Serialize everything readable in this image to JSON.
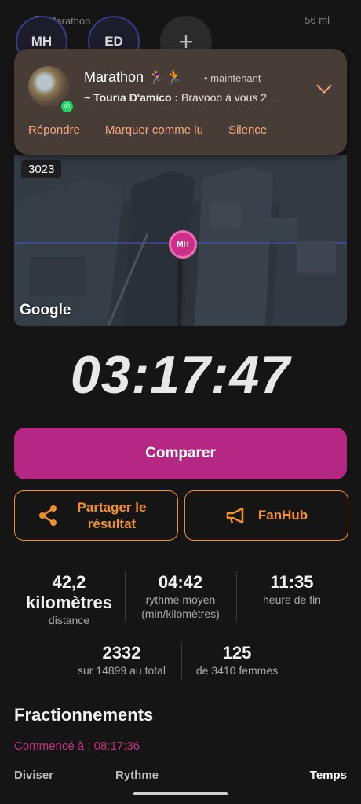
{
  "status_bar": {
    "app": "Marathon",
    "time": "56 ml"
  },
  "top_avatars": [
    {
      "initials": "MH"
    },
    {
      "initials": "ED"
    },
    {
      "initials": "+"
    }
  ],
  "notification": {
    "title": "Marathon 🏃‍♀️🏃",
    "time": "• maintenant",
    "sender": "~ Touria D'amico :",
    "message": " Bravooo à vous 2 …",
    "actions": [
      "Répondre",
      "Marquer comme lu",
      "Silence"
    ]
  },
  "map": {
    "counter": "3023",
    "marker": "MH",
    "attribution": "Google"
  },
  "timer": "03:17:47",
  "buttons": {
    "compare": "Comparer",
    "share": "Partager le résultat",
    "fanhub": "FanHub"
  },
  "stats": {
    "distance_value": "42,2 kilomètres",
    "distance_label": "distance",
    "pace_value": "04:42",
    "pace_label": "rythme moyen (min/kilomètres)",
    "finish_value": "11:35",
    "finish_label": "heure de fin",
    "overall_value": "2332",
    "overall_label": "sur 14899 au total",
    "gender_value": "125",
    "gender_label": "de 3410 femmes"
  },
  "splits": {
    "title": "Fractionnements",
    "started": "Commencé à : 08:17:36",
    "columns": [
      "Diviser",
      "Rythme",
      "Temps"
    ]
  },
  "colors": {
    "accent_pink": "#b42883",
    "accent_orange": "#f39129",
    "background": "#151515"
  }
}
